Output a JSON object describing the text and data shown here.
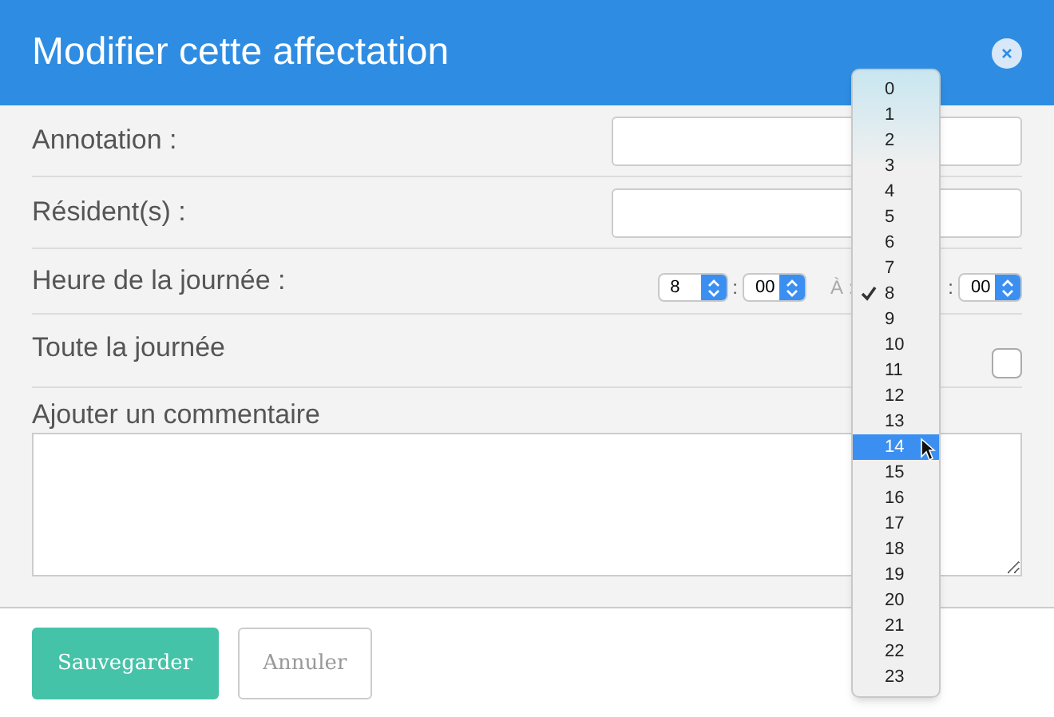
{
  "dialog": {
    "title": "Modifier cette affectation"
  },
  "fields": [
    {
      "kind": "text",
      "label": "Annotation :"
    },
    {
      "kind": "text",
      "label": "Résident(s) :"
    },
    {
      "kind": "time",
      "label": "Heure de la journée :",
      "start_hour": "8",
      "start_minute": "00",
      "separator": ":",
      "to_label": "À :",
      "end_separator": ":",
      "end_minute": "00"
    },
    {
      "kind": "checkbox",
      "label": "Toute la journée",
      "checked": false
    },
    {
      "kind": "textarea",
      "label": "Ajouter un commentaire"
    }
  ],
  "hour_menu": [
    {
      "label": "0",
      "checked": false,
      "selected": false
    },
    {
      "label": "1",
      "checked": false,
      "selected": false
    },
    {
      "label": "2",
      "checked": false,
      "selected": false
    },
    {
      "label": "3",
      "checked": false,
      "selected": false
    },
    {
      "label": "4",
      "checked": false,
      "selected": false
    },
    {
      "label": "5",
      "checked": false,
      "selected": false
    },
    {
      "label": "6",
      "checked": false,
      "selected": false
    },
    {
      "label": "7",
      "checked": false,
      "selected": false
    },
    {
      "label": "8",
      "checked": true,
      "selected": false
    },
    {
      "label": "9",
      "checked": false,
      "selected": false
    },
    {
      "label": "10",
      "checked": false,
      "selected": false
    },
    {
      "label": "11",
      "checked": false,
      "selected": false
    },
    {
      "label": "12",
      "checked": false,
      "selected": false
    },
    {
      "label": "13",
      "checked": false,
      "selected": false
    },
    {
      "label": "14",
      "checked": false,
      "selected": true
    },
    {
      "label": "15",
      "checked": false,
      "selected": false
    },
    {
      "label": "16",
      "checked": false,
      "selected": false
    },
    {
      "label": "17",
      "checked": false,
      "selected": false
    },
    {
      "label": "18",
      "checked": false,
      "selected": false
    },
    {
      "label": "19",
      "checked": false,
      "selected": false
    },
    {
      "label": "20",
      "checked": false,
      "selected": false
    },
    {
      "label": "21",
      "checked": false,
      "selected": false
    },
    {
      "label": "22",
      "checked": false,
      "selected": false
    },
    {
      "label": "23",
      "checked": false,
      "selected": false
    }
  ],
  "buttons": [
    {
      "kind": "primary",
      "label": "Sauvegarder"
    },
    {
      "kind": "secondary",
      "label": "Annuler"
    }
  ]
}
